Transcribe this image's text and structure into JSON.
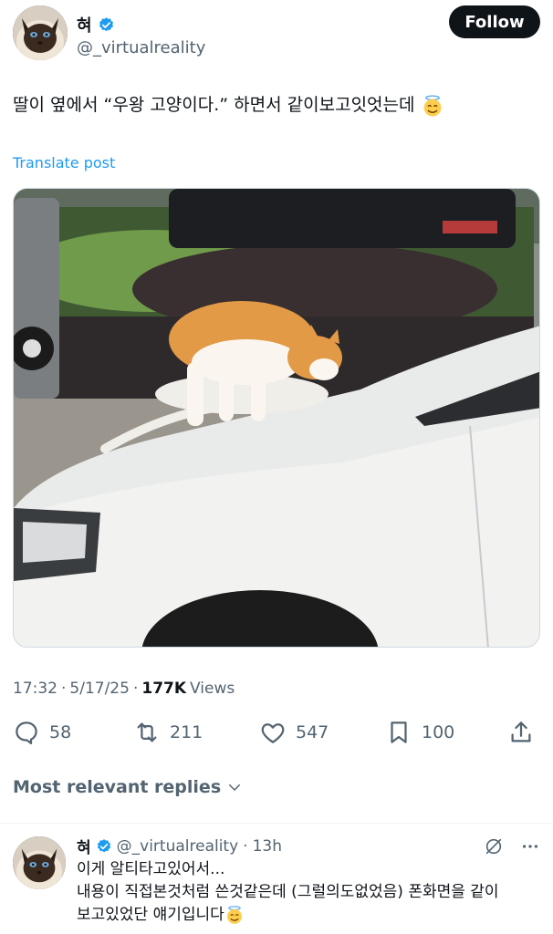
{
  "author": {
    "name": "혀",
    "handle": "@_virtualreality",
    "verified": true,
    "avatar_icon": "siamese-cat-avatar"
  },
  "follow_label": "Follow",
  "tweet": {
    "text": "딸이 옆에서 “우왕 고양이다.” 하면서 같이보고잇엇는데",
    "emoji_icon": "smiling-face-with-halo-emoji",
    "translate_label": "Translate post",
    "media_description_icon": "cat-on-car-hood-photo"
  },
  "meta": {
    "time": "17:32",
    "separator": "·",
    "date": "5/17/25",
    "views_count": "177K",
    "views_label": "Views"
  },
  "actions": {
    "replies": "58",
    "reposts": "211",
    "likes": "547",
    "bookmarks": "100"
  },
  "replies_section": {
    "title": "Most relevant replies"
  },
  "reply": {
    "name": "혀",
    "handle": "@_virtualreality",
    "time": "13h",
    "line1": "이게 알티타고있어서...",
    "line2": "내용이 직접본것처럼 쓴것같은데 (그럴의도없었음) 폰화면을 같이",
    "line3": "보고있었단 얘기입니다"
  },
  "colors": {
    "accent": "#1d9bf0",
    "text_primary": "#0f1419",
    "text_secondary": "#536471",
    "button_bg": "#0f1419"
  }
}
